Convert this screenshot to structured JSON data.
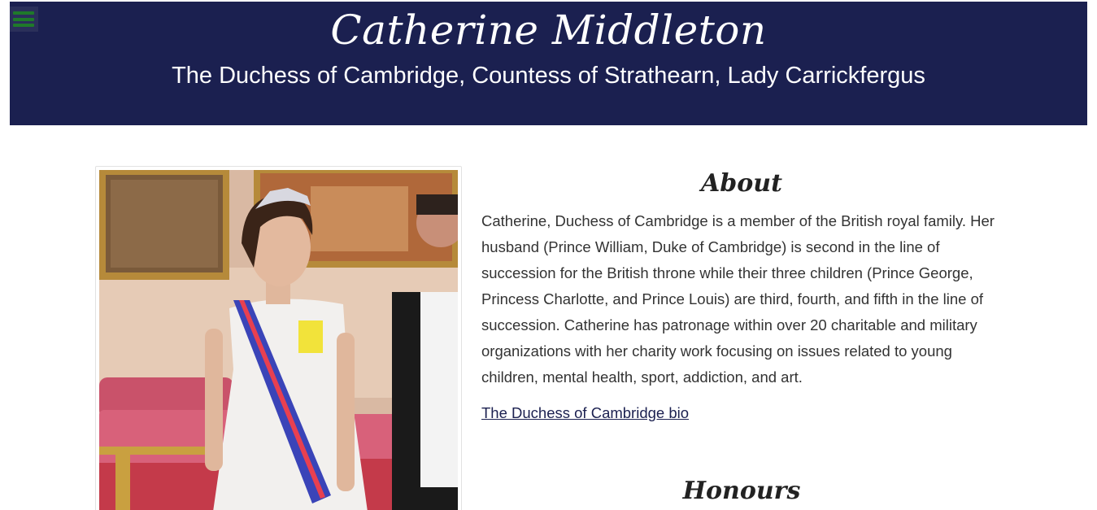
{
  "header": {
    "title": "Catherine Middleton",
    "subtitle": "The Duchess of Cambridge, Countess of Strathearn, Lady Carrickfergus",
    "background_color": "#1b2050",
    "menu_icon": "hamburger-menu-icon"
  },
  "photo": {
    "alt": "Catherine, Duchess of Cambridge"
  },
  "about": {
    "heading": "About",
    "text": "Catherine, Duchess of Cambridge is a member of the British royal family. Her husband (Prince William, Duke of Cambridge) is second in the line of succession for the British throne while their three children (Prince George, Princess Charlotte, and Prince Louis) are third, fourth, and fifth in the line of succession. Catherine has patronage within over 20 charitable and military organizations with her charity work focusing on issues related to young children, mental health, sport, addiction, and art.",
    "link_label": "The Duchess of Cambridge bio"
  },
  "honours": {
    "heading": "Honours"
  }
}
